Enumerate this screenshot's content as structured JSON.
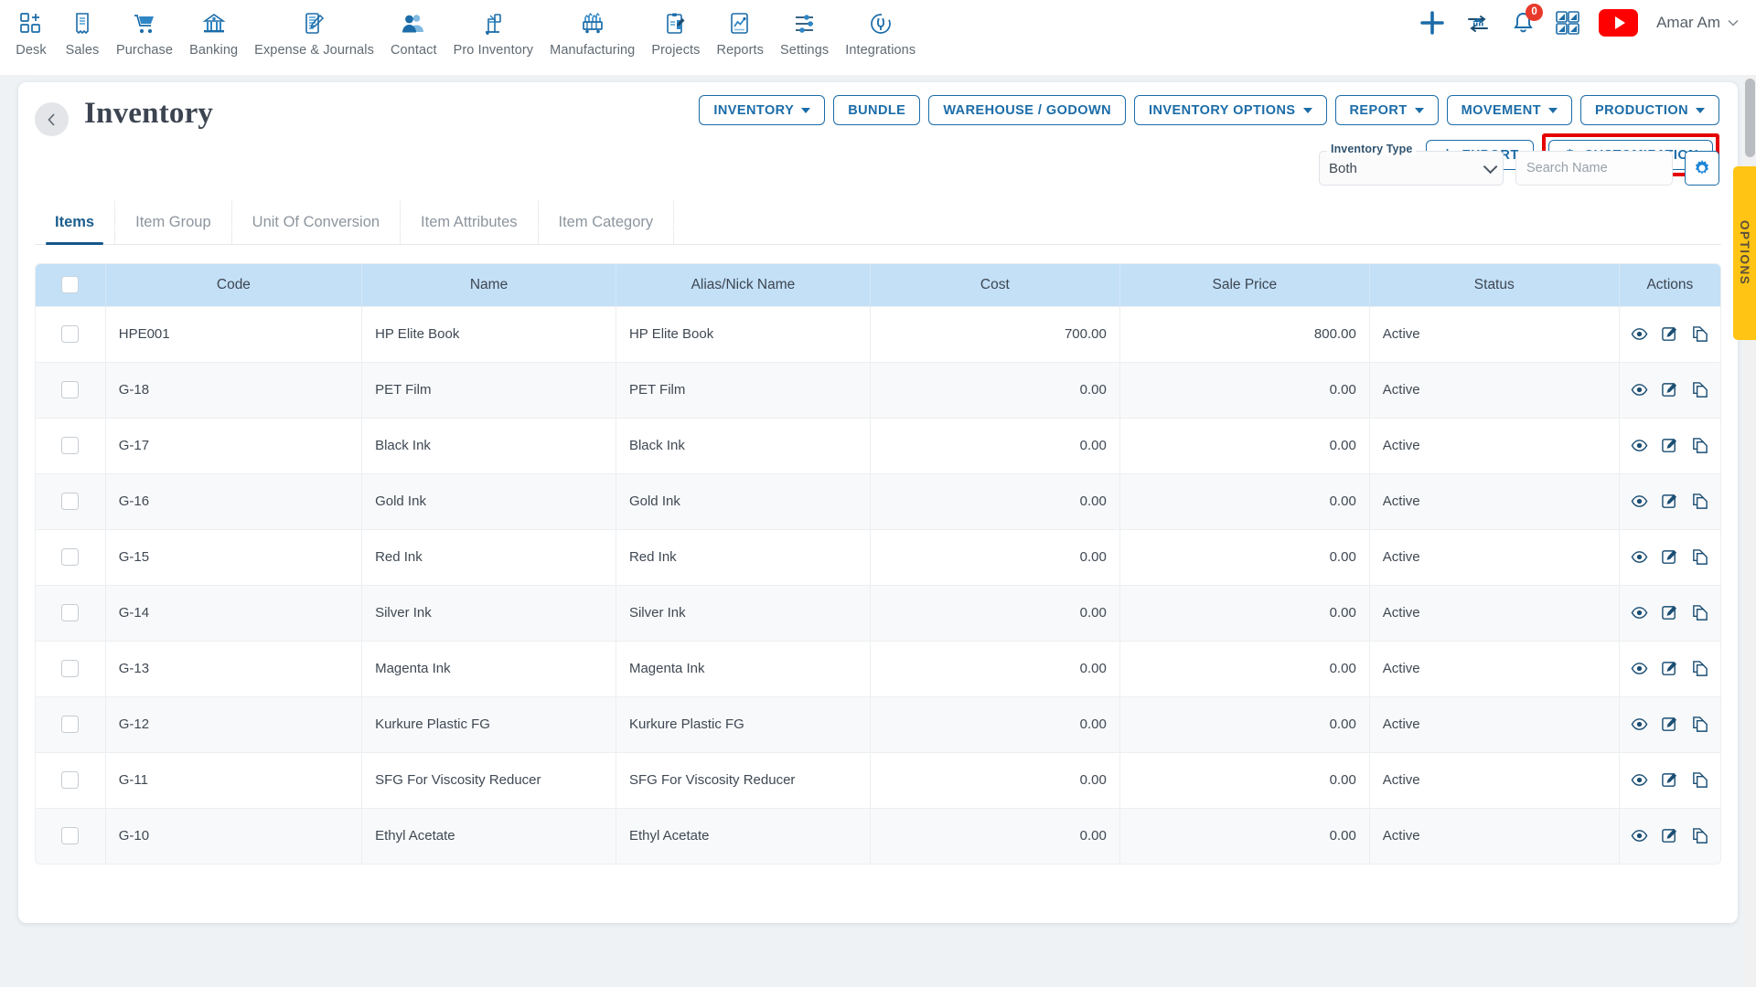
{
  "topnav": {
    "items": [
      {
        "label": "Desk",
        "icon": "desk-grid-plus-icon"
      },
      {
        "label": "Sales",
        "icon": "sales-receipt-icon"
      },
      {
        "label": "Purchase",
        "icon": "purchase-cart-icon"
      },
      {
        "label": "Banking",
        "icon": "banking-bank-icon"
      },
      {
        "label": "Expense & Journals",
        "icon": "expense-journal-icon"
      },
      {
        "label": "Contact",
        "icon": "contact-people-icon"
      },
      {
        "label": "Pro Inventory",
        "icon": "pro-inventory-icon"
      },
      {
        "label": "Manufacturing",
        "icon": "manufacturing-icon"
      },
      {
        "label": "Projects",
        "icon": "projects-clipboard-icon"
      },
      {
        "label": "Reports",
        "icon": "reports-chart-icon"
      },
      {
        "label": "Settings",
        "icon": "settings-sliders-icon"
      },
      {
        "label": "Integrations",
        "icon": "integrations-plug-icon"
      }
    ],
    "right": {
      "add_icon": "plus-icon",
      "transfer_icon": "bank-transfer-icon",
      "bell_icon": "bell-icon",
      "notification_count": "0",
      "apps_icon": "apps-grid-icon",
      "youtube_icon": "youtube-play-icon",
      "user_name": "Amar Am",
      "user_chevron_icon": "chevron-down-icon"
    }
  },
  "page": {
    "back_icon": "chevron-left-icon",
    "title": "Inventory"
  },
  "toolbar": {
    "row1": [
      {
        "label": "INVENTORY",
        "caret": true
      },
      {
        "label": "BUNDLE",
        "caret": false
      },
      {
        "label": "WAREHOUSE / GODOWN",
        "caret": false
      },
      {
        "label": "INVENTORY OPTIONS",
        "caret": true
      },
      {
        "label": "REPORT",
        "caret": true
      },
      {
        "label": "MOVEMENT",
        "caret": true
      },
      {
        "label": "PRODUCTION",
        "caret": true
      }
    ],
    "export_label": "EXPORT",
    "export_icon": "download-icon",
    "customization_label": "CUSTOMIZATION",
    "customization_icon": "gear-icon",
    "highlight_color": "#e60000"
  },
  "filters": {
    "inventory_type_label": "Inventory Type",
    "inventory_type_value": "Both",
    "search_placeholder": "Search Name",
    "search_value": "",
    "search_icon": "search-icon",
    "settings_icon": "gear-icon"
  },
  "tabs": [
    {
      "label": "Items",
      "active": true
    },
    {
      "label": "Item Group",
      "active": false
    },
    {
      "label": "Unit Of Conversion",
      "active": false
    },
    {
      "label": "Item Attributes",
      "active": false
    },
    {
      "label": "Item Category",
      "active": false
    }
  ],
  "table": {
    "columns": [
      "",
      "Code",
      "Name",
      "Alias/Nick Name",
      "Cost",
      "Sale Price",
      "Status",
      "Actions"
    ],
    "row_actions": [
      "view-icon",
      "edit-icon",
      "copy-icon"
    ],
    "rows": [
      {
        "code": "HPE001",
        "name": "HP Elite Book",
        "alias": "HP Elite Book",
        "cost": "700.00",
        "price": "800.00",
        "status": "Active"
      },
      {
        "code": "G-18",
        "name": "PET Film",
        "alias": "PET Film",
        "cost": "0.00",
        "price": "0.00",
        "status": "Active"
      },
      {
        "code": "G-17",
        "name": "Black Ink",
        "alias": "Black Ink",
        "cost": "0.00",
        "price": "0.00",
        "status": "Active"
      },
      {
        "code": "G-16",
        "name": "Gold Ink",
        "alias": "Gold Ink",
        "cost": "0.00",
        "price": "0.00",
        "status": "Active"
      },
      {
        "code": "G-15",
        "name": "Red Ink",
        "alias": "Red Ink",
        "cost": "0.00",
        "price": "0.00",
        "status": "Active"
      },
      {
        "code": "G-14",
        "name": "Silver Ink",
        "alias": "Silver Ink",
        "cost": "0.00",
        "price": "0.00",
        "status": "Active"
      },
      {
        "code": "G-13",
        "name": "Magenta Ink",
        "alias": "Magenta Ink",
        "cost": "0.00",
        "price": "0.00",
        "status": "Active"
      },
      {
        "code": "G-12",
        "name": "Kurkure Plastic FG",
        "alias": "Kurkure Plastic FG",
        "cost": "0.00",
        "price": "0.00",
        "status": "Active"
      },
      {
        "code": "G-11",
        "name": "SFG For Viscosity Reducer",
        "alias": "SFG For Viscosity Reducer",
        "cost": "0.00",
        "price": "0.00",
        "status": "Active"
      },
      {
        "code": "G-10",
        "name": "Ethyl Acetate",
        "alias": "Ethyl Acetate",
        "cost": "0.00",
        "price": "0.00",
        "status": "Active"
      }
    ]
  },
  "side_tab": {
    "label": "OPTIONS",
    "color": "#ffc414"
  },
  "theme": {
    "accent": "#1b6ca8",
    "header_bg": "#c3e0f7",
    "page_bg": "#eef2f5"
  }
}
